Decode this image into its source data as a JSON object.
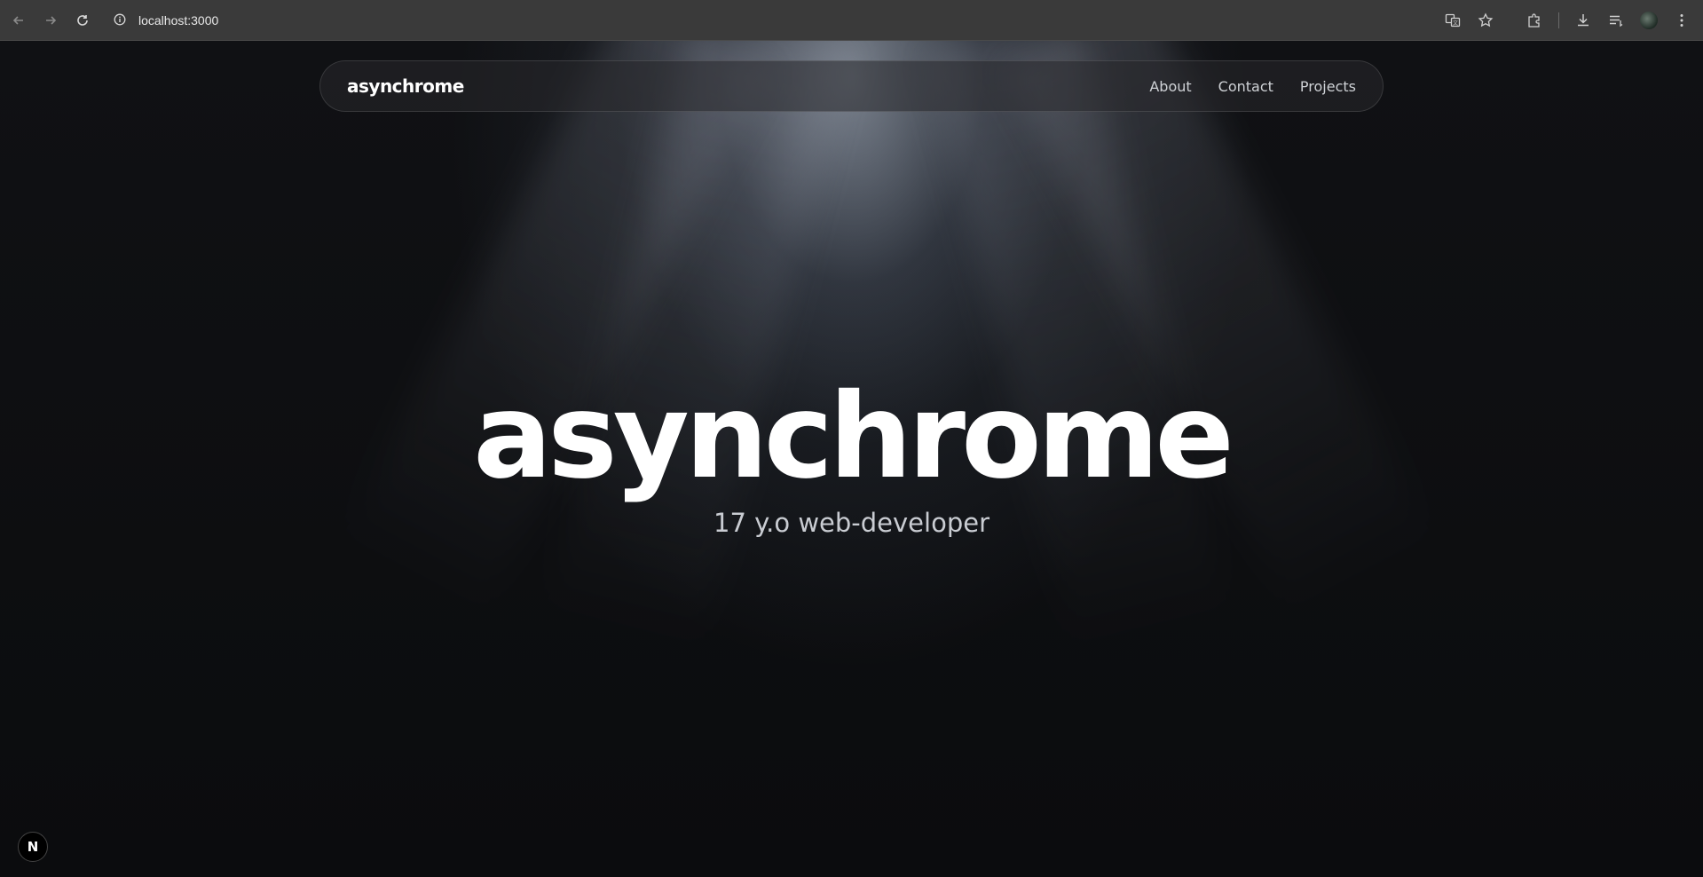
{
  "browser": {
    "url": "localhost:3000",
    "icons": [
      "back-arrow-icon",
      "forward-arrow-icon",
      "reload-icon",
      "site-info-icon",
      "translate-icon",
      "bookmark-star-icon",
      "extensions-icon",
      "download-icon",
      "reading-list-icon",
      "profile-avatar",
      "more-menu-icon"
    ]
  },
  "navbar": {
    "logo": "asynchrome",
    "links": [
      "About",
      "Contact",
      "Projects"
    ]
  },
  "hero": {
    "title": "asynchrome",
    "subtitle": "17 y.o web-developer"
  },
  "badge": {
    "label": "N"
  },
  "colors": {
    "background": "#0d0e10",
    "text_primary": "#ffffff",
    "text_secondary": "#c9ccd2",
    "browser_bar": "#3a3a3a"
  }
}
